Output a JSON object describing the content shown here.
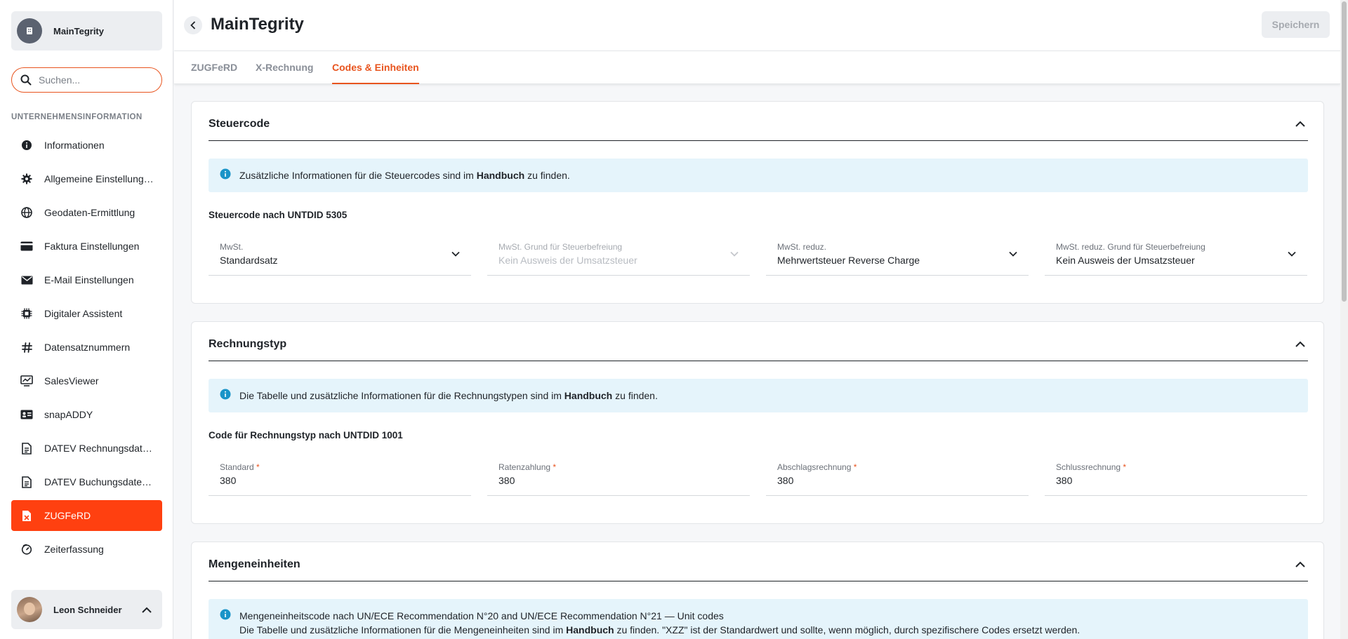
{
  "sidebar": {
    "org_name": "MainTegrity",
    "search": {
      "placeholder": "Suchen...",
      "value": ""
    },
    "section_title": "UNTERNEHMENSINFORMATION",
    "items": [
      {
        "label": "Informationen",
        "icon": "info-circle-icon"
      },
      {
        "label": "Allgemeine Einstellungen",
        "icon": "gear-icon"
      },
      {
        "label": "Geodaten-Ermittlung",
        "icon": "globe-icon"
      },
      {
        "label": "Faktura Einstellungen",
        "icon": "credit-card-icon"
      },
      {
        "label": "E-Mail Einstellungen",
        "icon": "mail-icon"
      },
      {
        "label": "Digitaler Assistent",
        "icon": "chip-icon"
      },
      {
        "label": "Datensatznummern",
        "icon": "hash-icon"
      },
      {
        "label": "SalesViewer",
        "icon": "monitor-chart-icon"
      },
      {
        "label": "snapADDY",
        "icon": "id-card-icon"
      },
      {
        "label": "DATEV Rechnungsdatenservice",
        "icon": "document-icon"
      },
      {
        "label": "DATEV Buchungsdatenservice",
        "icon": "document-icon"
      },
      {
        "label": "ZUGFeRD",
        "icon": "file-x-icon",
        "active": true
      },
      {
        "label": "Zeiterfassung",
        "icon": "stopwatch-icon"
      }
    ],
    "user_name": "Leon Schneider"
  },
  "header": {
    "title": "MainTegrity",
    "save_label": "Speichern"
  },
  "tabs": [
    {
      "label": "ZUGFeRD"
    },
    {
      "label": "X-Rechnung"
    },
    {
      "label": "Codes & Einheiten",
      "active": true
    }
  ],
  "steuercode": {
    "title": "Steuercode",
    "info_pre": "Zusätzliche Informationen für die Steuercodes sind im ",
    "info_bold": "Handbuch",
    "info_post": " zu finden.",
    "subtitle": "Steuercode nach UNTDID 5305",
    "fields": [
      {
        "label": "MwSt.",
        "value": "Standardsatz"
      },
      {
        "label": "MwSt. Grund für Steuerbefreiung",
        "value": "Kein Ausweis der Umsatzsteuer",
        "disabled": true
      },
      {
        "label": "MwSt. reduz.",
        "value": "Mehrwertsteuer Reverse Charge"
      },
      {
        "label": "MwSt. reduz. Grund für Steuerbefreiung",
        "value": "Kein Ausweis der Umsatzsteuer"
      }
    ]
  },
  "rechnungstyp": {
    "title": "Rechnungstyp",
    "info_pre": "Die Tabelle und zusätzliche Informationen für die Rechnungstypen sind im ",
    "info_bold": "Handbuch",
    "info_post": " zu finden.",
    "subtitle": "Code für Rechnungstyp nach UNTDID 1001",
    "fields": [
      {
        "label": "Standard",
        "value": "380"
      },
      {
        "label": "Ratenzahlung",
        "value": "380"
      },
      {
        "label": "Abschlagsrechnung",
        "value": "380"
      },
      {
        "label": "Schlussrechnung",
        "value": "380"
      }
    ],
    "required_mark": "*"
  },
  "mengeneinheiten": {
    "title": "Mengeneinheiten",
    "info_line1": "Mengeneinheitscode nach UN/ECE Recommendation N°20 and UN/ECE Recommendation N°21 — Unit codes",
    "info_pre": "Die Tabelle und zusätzliche Informationen für die Mengeneinheiten sind im ",
    "info_bold": "Handbuch",
    "info_post": " zu finden. \"XZZ\" ist der Standardwert und sollte, wenn möglich, durch spezifischere Codes ersetzt werden."
  },
  "colors": {
    "accent": "#e8541e",
    "active_nav": "#ff4010",
    "info_bg": "#e5f4fb",
    "info_icon": "#1a94c8"
  }
}
